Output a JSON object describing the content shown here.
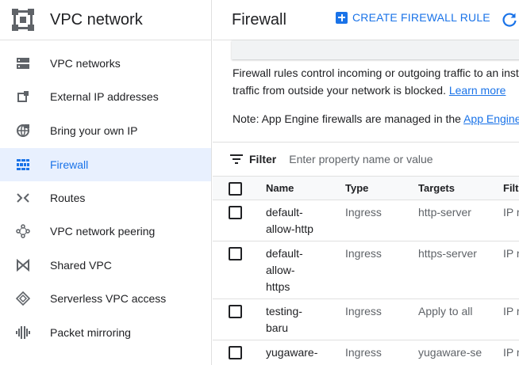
{
  "sidebar": {
    "title": "VPC network",
    "logo_icon": "vpc-network-icon",
    "items": [
      {
        "label": "VPC networks",
        "icon": "vpc-networks-icon",
        "active": false
      },
      {
        "label": "External IP addresses",
        "icon": "external-ip-icon",
        "active": false
      },
      {
        "label": "Bring your own IP",
        "icon": "byoip-globe-icon",
        "active": false
      },
      {
        "label": "Firewall",
        "icon": "firewall-icon",
        "active": true
      },
      {
        "label": "Routes",
        "icon": "routes-icon",
        "active": false
      },
      {
        "label": "VPC network peering",
        "icon": "peering-icon",
        "active": false
      },
      {
        "label": "Shared VPC",
        "icon": "shared-vpc-icon",
        "active": false
      },
      {
        "label": "Serverless VPC access",
        "icon": "serverless-vpc-icon",
        "active": false
      },
      {
        "label": "Packet mirroring",
        "icon": "packet-mirroring-icon",
        "active": false
      }
    ]
  },
  "header": {
    "title": "Firewall",
    "create_label": "CREATE FIREWALL RULE",
    "create_icon": "add-box-icon",
    "refresh_icon": "refresh-icon"
  },
  "description": {
    "line1": "Firewall rules control incoming or outgoing traffic to an insta",
    "line2": "traffic from outside your network is blocked.",
    "learn_more": "Learn more"
  },
  "note": {
    "text": "Note: App Engine firewalls are managed in the",
    "link": "App Engine F"
  },
  "filter": {
    "label": "Filter",
    "placeholder": "Enter property name or value",
    "icon": "filter-icon"
  },
  "table": {
    "columns": [
      "Name",
      "Type",
      "Targets",
      "Filte"
    ],
    "rows": [
      {
        "name": "default-allow-http",
        "name_lines": [
          "default-",
          "allow-http"
        ],
        "type": "Ingress",
        "targets": "http-server",
        "filter": "IP r"
      },
      {
        "name": "default-allow-https",
        "name_lines": [
          "default-",
          "allow-",
          "https"
        ],
        "type": "Ingress",
        "targets": "https-server",
        "filter": "IP r"
      },
      {
        "name": "testing-baru",
        "name_lines": [
          "testing-",
          "baru"
        ],
        "type": "Ingress",
        "targets": "Apply to all",
        "filter": "IP r"
      },
      {
        "name": "yugaware-",
        "name_lines": [
          "yugaware-"
        ],
        "type": "Ingress",
        "targets": "yugaware-se",
        "filter": "IP r"
      }
    ]
  },
  "colors": {
    "accent": "#1a73e8",
    "active_bg": "#e8f0fe",
    "text": "#202124",
    "muted": "#5f6368"
  }
}
